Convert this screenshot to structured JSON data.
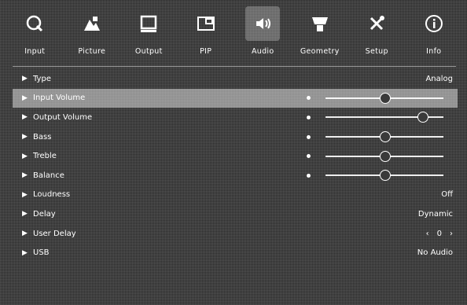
{
  "tabs": [
    {
      "label": "Input",
      "icon": "input-icon",
      "active": false
    },
    {
      "label": "Picture",
      "icon": "picture-icon",
      "active": false
    },
    {
      "label": "Output",
      "icon": "output-icon",
      "active": false
    },
    {
      "label": "PIP",
      "icon": "pip-icon",
      "active": false
    },
    {
      "label": "Audio",
      "icon": "audio-icon",
      "active": true
    },
    {
      "label": "Geometry",
      "icon": "geometry-icon",
      "active": false
    },
    {
      "label": "Setup",
      "icon": "setup-icon",
      "active": false
    },
    {
      "label": "Info",
      "icon": "info-icon",
      "active": false
    }
  ],
  "rows": {
    "type": {
      "label": "Type",
      "value": "Analog"
    },
    "input_volume": {
      "label": "Input Volume",
      "level": 0.5,
      "selected": true
    },
    "output_volume": {
      "label": "Output Volume",
      "level": 0.82
    },
    "bass": {
      "label": "Bass",
      "level": 0.5
    },
    "treble": {
      "label": "Treble",
      "level": 0.5
    },
    "balance": {
      "label": "Balance",
      "level": 0.5
    },
    "loudness": {
      "label": "Loudness",
      "value": "Off"
    },
    "delay": {
      "label": "Delay",
      "value": "Dynamic"
    },
    "user_delay": {
      "label": "User Delay",
      "value": "0",
      "left": "‹",
      "right": "›"
    },
    "usb": {
      "label": "USB",
      "value": "No Audio"
    }
  }
}
